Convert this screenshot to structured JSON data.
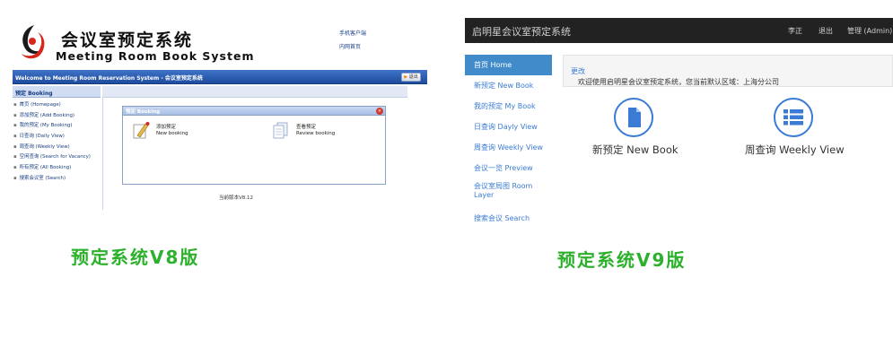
{
  "v8": {
    "brand_cn": "会议室预定系统",
    "brand_en": "Meeting Room Book System",
    "top_links": [
      "手机客户端",
      "内网首页"
    ],
    "banner_text": "Welcome to Meeting Room Reservation System - 会议室预定系统",
    "banner_button": "退出",
    "sidebar_title": "预定 Booking",
    "sidebar_items": [
      "首页 (Homepage)",
      "添加预定 (Add Booking)",
      "我的预定 (My Booking)",
      "日查询 (Daily View)",
      "周查询 (Weekly View)",
      "空闲查询 (Search for Vacancy)",
      "所有预定 (All Booking)",
      "搜索会议室 (Search)"
    ],
    "dialog_title": "预定 Booking",
    "options": [
      {
        "cn": "添加预定",
        "en": "New booking"
      },
      {
        "cn": "查看预定",
        "en": "Review booking"
      }
    ],
    "version": "当前版本V8.12",
    "caption": "预定系统V8版"
  },
  "v9": {
    "app_title": "启明星会议室预定系统",
    "nav": [
      "李正",
      "退出",
      "管理 (Admin)"
    ],
    "sidebar_items": [
      "首页 Home",
      "新预定 New Book",
      "我的预定 My Book",
      "日查询 Dayly View",
      "周查询 Weekly View",
      "会议一览 Preview",
      "会议室局图 Room Layer",
      "搜索会议 Search"
    ],
    "active_index": 0,
    "notice_text": "欢迎使用启明星会议室预定系统，您当前默认区域：上海分公司",
    "notice_link": "更改",
    "tiles": [
      {
        "label": "新预定 New Book",
        "icon": "document-icon"
      },
      {
        "label": "周查询 Weekly View",
        "icon": "list-icon"
      }
    ],
    "accent": "#428bca",
    "caption": "预定系统V9版"
  },
  "colors": {
    "caption_green": "#2db12d",
    "topbar_dark": "#222222",
    "v8_banner_blue": "#2a5db0"
  }
}
